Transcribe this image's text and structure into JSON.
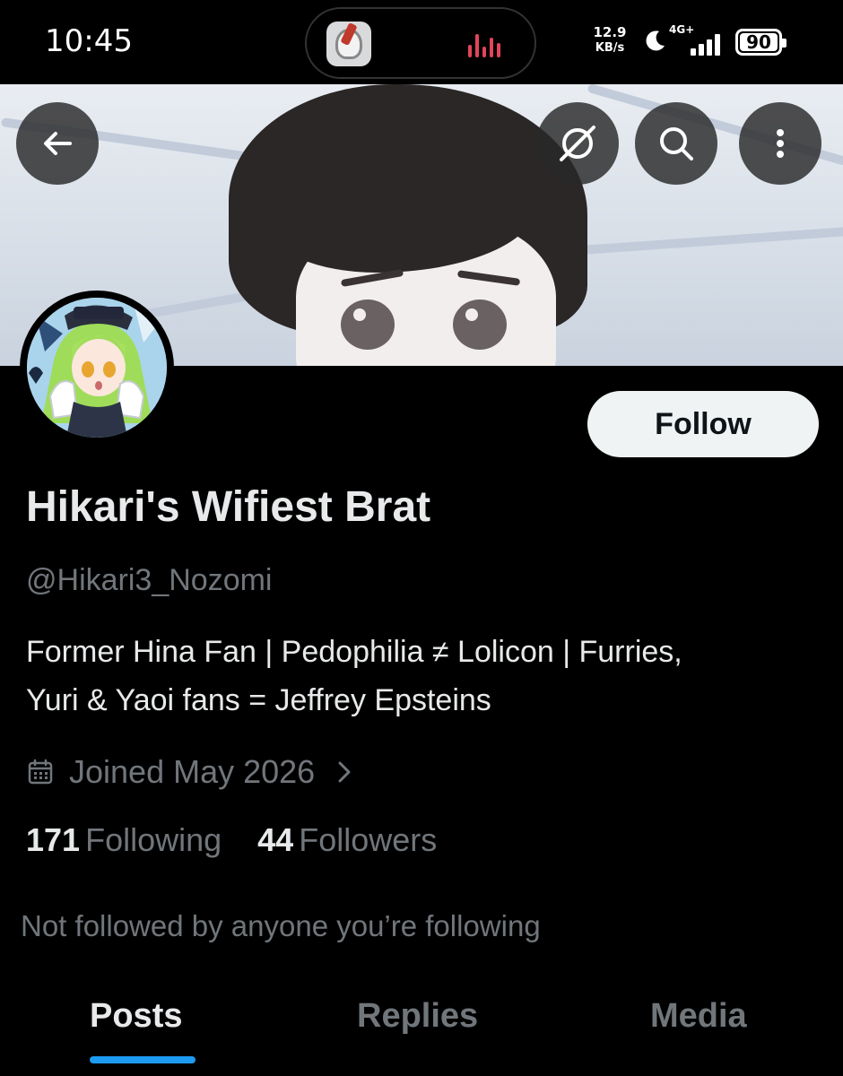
{
  "status_bar": {
    "time": "10:45",
    "net_speed_value": "12.9",
    "net_speed_unit": "KB/s",
    "signal_type": "4G+",
    "battery": "90",
    "icons": [
      "moon-icon",
      "signal-icon",
      "battery-icon"
    ]
  },
  "header": {
    "back_icon": "arrow-left-icon",
    "actions": [
      "grok-icon",
      "search-icon",
      "more-vertical-icon"
    ]
  },
  "profile": {
    "display_name": "Hikari's Wifiest Brat",
    "handle": "@Hikari3_Nozomi",
    "bio_line1": "Former Hina Fan | Pedophilia ≠ Lolicon | Furries,",
    "bio_line2": "Yuri & Yaoi fans = Jeffrey Epsteins",
    "joined": "Joined May 2026",
    "following_count": "171",
    "following_label": "Following",
    "followers_count": "44",
    "followers_label": "Followers",
    "not_followed_note": "Not followed by anyone you’re following",
    "follow_button": "Follow"
  },
  "tabs": [
    "Posts",
    "Replies",
    "Media"
  ],
  "active_tab": "Posts",
  "colors": {
    "background": "#000000",
    "primary_text": "#e7e9ea",
    "secondary_text": "#71767b",
    "accent": "#1d9bf0",
    "follow_button_bg": "#eff3f4"
  }
}
